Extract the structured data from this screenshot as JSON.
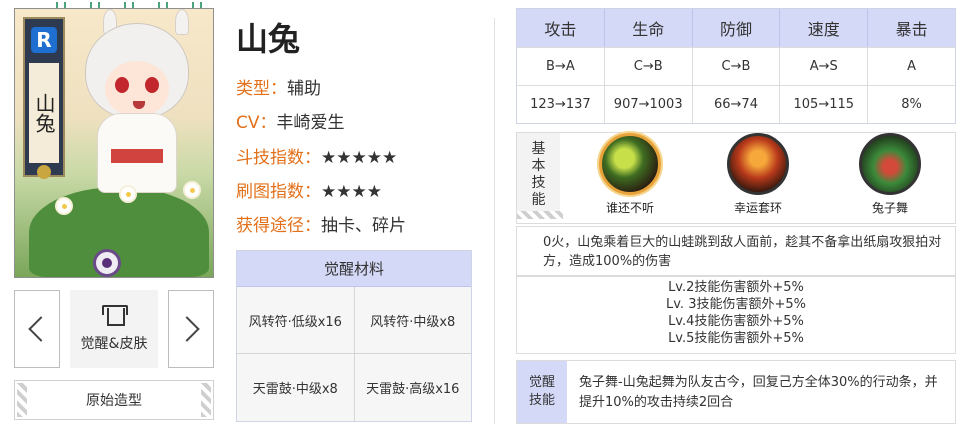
{
  "toolbar": {
    "icons": [
      "copy-icon",
      "fullscreen-icon",
      "save-icon",
      "edit-icon",
      "settings-icon"
    ]
  },
  "card": {
    "name_vertical": "山兔",
    "rarity": "R"
  },
  "nav": {
    "awaken_skin_label": "觉醒&皮肤",
    "original_form_label": "原始造型"
  },
  "profile": {
    "name": "山兔",
    "type_key": "类型",
    "type_val": "辅助",
    "cv_key": "CV",
    "cv_val": "丰崎爱生",
    "battle_key": "斗技指数",
    "battle_val": "★★★★★",
    "farm_key": "刷图指数",
    "farm_val": "★★★★",
    "source_key": "获得途径",
    "source_val": "抽卡、碎片",
    "sep": "："
  },
  "materials": {
    "title": "觉醒材料",
    "rows": [
      [
        "风转符·低级x16",
        "风转符·中级x8"
      ],
      [
        "天雷鼓·中级x8",
        "天雷鼓·高级x16"
      ]
    ]
  },
  "stats": {
    "headers": [
      "攻击",
      "生命",
      "防御",
      "速度",
      "暴击"
    ],
    "grades": [
      "B→A",
      "C→B",
      "C→B",
      "A→S",
      "A"
    ],
    "values": [
      "123→137",
      "907→1003",
      "66→74",
      "105→115",
      "8%"
    ]
  },
  "skills": {
    "tab_label": "基本技能",
    "items": [
      {
        "name": "谁还不听"
      },
      {
        "name": "幸运套环"
      },
      {
        "name": "兔子舞"
      }
    ],
    "description": "0火，山兔乘着巨大的山蛙跳到敌人面前，趁其不备拿出纸扇攻狠拍对方，造成100%的伤害",
    "levels": [
      "Lv.2技能伤害额外+5%",
      "Lv. 3技能伤害额外+5%",
      "Lv.4技能伤害额外+5%",
      "Lv.5技能伤害额外+5%"
    ]
  },
  "awaken": {
    "tab_label": "觉醒技能",
    "text": "兔子舞-山兔起舞为队友古今，回复己方全体30%的行动条，并提升10%的攻击持续2回合"
  },
  "colors": {
    "accent_orange": "#e3701a",
    "header_blue": "#d4d9f7",
    "selected_ring": "#e8a23a"
  }
}
